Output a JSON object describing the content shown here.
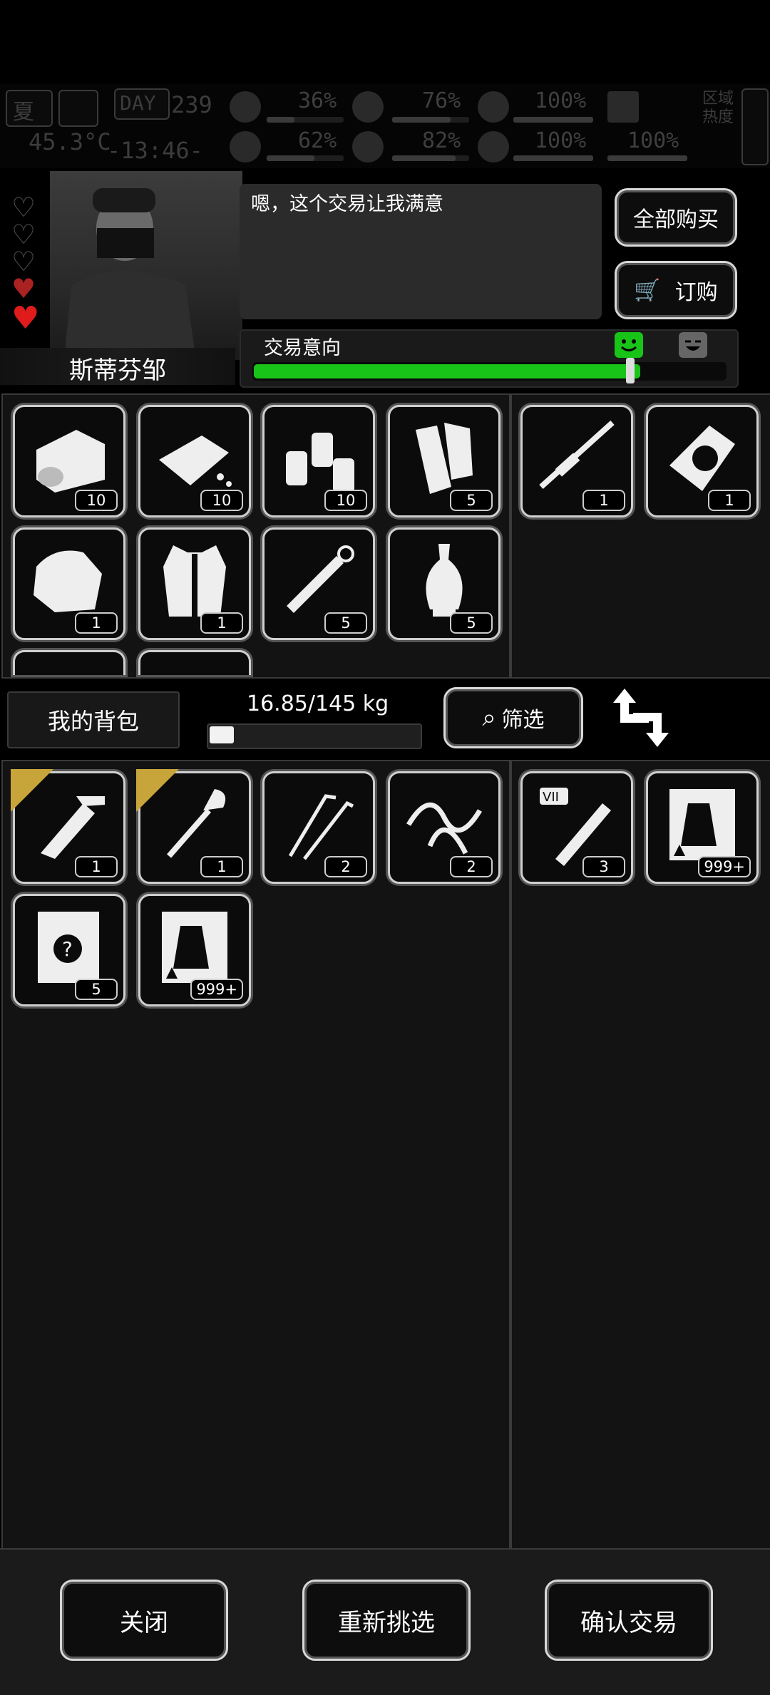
{
  "hud": {
    "season": "夏",
    "day_label": "DAY",
    "day": "239",
    "temperature": "45.3°C",
    "clock": "-13:46-",
    "stats": [
      "36%",
      "76%",
      "100%",
      "62%",
      "82%",
      "100%",
      "100%"
    ],
    "zone_heat": "区域热度"
  },
  "trader": {
    "name": "斯蒂芬邹",
    "speech": "嗯，这个交易让我满意",
    "buy_all": "全部购买",
    "order": "订购",
    "intent_label": "交易意向",
    "intent_level": 0.82
  },
  "trader_items": [
    {
      "name": "canned-food",
      "count": "10"
    },
    {
      "name": "bread",
      "count": "10"
    },
    {
      "name": "bottles",
      "count": "10"
    },
    {
      "name": "paper-rolls",
      "count": "5"
    },
    {
      "name": "cloth",
      "count": "1"
    },
    {
      "name": "vest",
      "count": "1"
    },
    {
      "name": "syringe",
      "count": "5"
    },
    {
      "name": "vase",
      "count": "5"
    }
  ],
  "trader_offer": [
    {
      "name": "sniper-rifle",
      "count": "1"
    },
    {
      "name": "engine-part",
      "count": "1"
    }
  ],
  "bag": {
    "label": "我的背包",
    "weight": "16.85/145 kg",
    "weight_level": 0.116,
    "filter": "筛选"
  },
  "bag_items": [
    {
      "name": "multitool",
      "count": "1",
      "starred": true
    },
    {
      "name": "shovel",
      "count": "1",
      "starred": true
    },
    {
      "name": "lockpicks",
      "count": "2",
      "starred": false
    },
    {
      "name": "rope",
      "count": "2",
      "starred": false
    },
    {
      "name": "mystery-book",
      "count": "5",
      "starred": false
    },
    {
      "name": "zombie-card",
      "count": "999+",
      "starred": false
    }
  ],
  "bag_offer": [
    {
      "name": "test-tube",
      "count": "3",
      "tag": "VII"
    },
    {
      "name": "zombie-card",
      "count": "999+"
    }
  ],
  "buttons": {
    "close": "关闭",
    "reselect": "重新挑选",
    "confirm": "确认交易"
  }
}
